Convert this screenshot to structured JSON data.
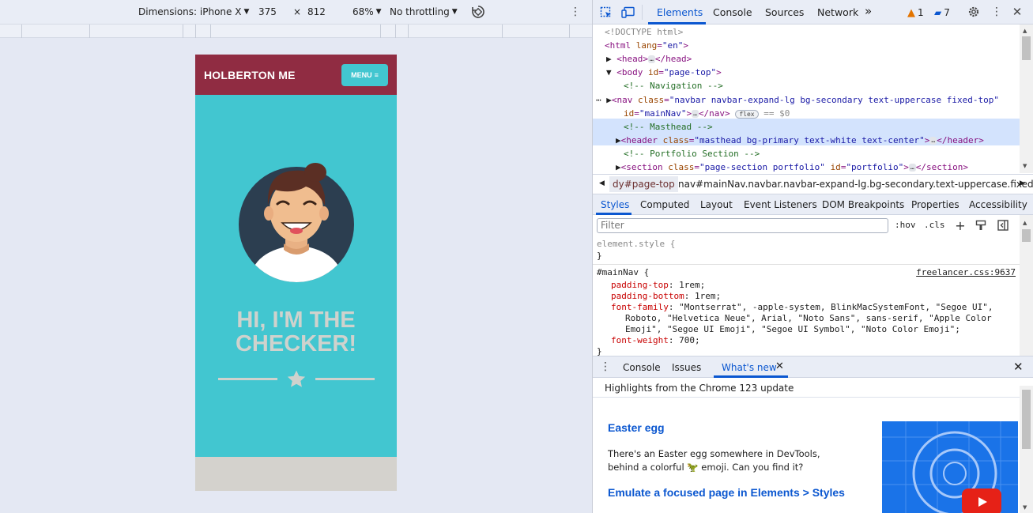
{
  "device_toolbar": {
    "dimensions_label": "Dimensions: iPhone X",
    "width": "375",
    "times": "×",
    "height": "812",
    "zoom": "68%",
    "throttling": "No throttling"
  },
  "phone": {
    "brand": "HOLBERTON ME",
    "menu_label": "MENU",
    "hero_line1": "HI, I'M THE",
    "hero_line2": "CHECKER!"
  },
  "devtools": {
    "tabs": [
      "Elements",
      "Console",
      "Sources",
      "Network"
    ],
    "more_tabs": "»",
    "warnings_count": "1",
    "messages_count": "7",
    "dom": {
      "doctype": "<!DOCTYPE html>",
      "html_open": "<html",
      "html_attr": "lang",
      "html_val": "\"en\"",
      "head_open": "<head>",
      "head_close": "</head>",
      "body_open": "<body",
      "body_attr": "id",
      "body_val": "\"page-top\"",
      "comment_nav": "<!-- Navigation -->",
      "nav_open": "<nav",
      "nav_class_attr": "class",
      "nav_class_val": "\"navbar navbar-expand-lg bg-secondary text-uppercase fixed-top\"",
      "nav_id_attr": "id",
      "nav_id_val": "\"mainNav\"",
      "nav_close": "</nav>",
      "flex_badge": "flex",
      "eq_dollar": "== $0",
      "comment_masthead": "<!-- Masthead -->",
      "header_open": "<header",
      "header_class_attr": "class",
      "header_class_val": "\"masthead bg-primary text-white text-center\"",
      "header_close": "</header>",
      "comment_portfolio": "<!-- Portfolio Section -->",
      "section_open": "<section",
      "section_class_attr": "class",
      "section_class_val": "\"page-section portfolio\"",
      "section_id_attr": "id",
      "section_id_val": "\"portfolio\"",
      "section_close": "</section>",
      "ellipsis": "…"
    },
    "breadcrumbs": [
      "dy#page-top",
      "nav#mainNav.navbar.navbar-expand-lg.bg-secondary.text-uppercase.fixed-top"
    ],
    "sub_tabs": [
      "Styles",
      "Computed",
      "Layout",
      "Event Listeners",
      "DOM Breakpoints",
      "Properties",
      "Accessibility"
    ],
    "filter_placeholder": "Filter",
    "hov": ":hov",
    "cls": ".cls",
    "styles": {
      "element_style": "element.style {",
      "close_brace": "}",
      "selector": "#mainNav {",
      "source": "freelancer.css:9637",
      "p1_name": "padding-top",
      "p1_val": "1rem;",
      "p2_name": "padding-bottom",
      "p2_val": "1rem;",
      "p3_name": "font-family",
      "p3_val_l1": "\"Montserrat\", -apple-system, BlinkMacSystemFont, \"Segoe UI\",",
      "p3_val_l2": "Roboto, \"Helvetica Neue\", Arial, \"Noto Sans\", sans-serif, \"Apple Color",
      "p3_val_l3": "Emoji\", \"Segoe UI Emoji\", \"Segoe UI Symbol\", \"Noto Color Emoji\";",
      "p4_name": "font-weight",
      "p4_val": "700;"
    },
    "drawer_tabs": [
      "Console",
      "Issues",
      "What's new"
    ],
    "whats_new": {
      "header": "Highlights from the Chrome 123 update",
      "title1": "Easter egg",
      "body1": "There's an Easter egg somewhere in DevTools, behind a colorful",
      "body1_emoji": "🦖",
      "body1_end": "emoji. Can you find it?",
      "title2": "Emulate a focused page in Elements > Styles"
    },
    "colors": {
      "accent": "#0b57d0",
      "nav_bg": "#902c42",
      "masthead_bg": "#42c6d0",
      "selection": "#d3e3fd"
    }
  }
}
